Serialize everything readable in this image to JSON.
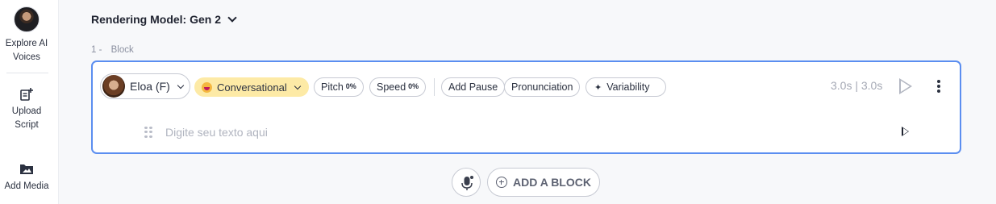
{
  "sidebar": {
    "items": [
      {
        "label_line1": "Explore AI",
        "label_line2": "Voices",
        "icon": "avatar-icon"
      },
      {
        "label_line1": "Upload",
        "label_line2": "Script",
        "icon": "upload-script-icon"
      },
      {
        "label_line1": "Add Media",
        "label_line2": "",
        "icon": "add-media-icon"
      }
    ]
  },
  "header": {
    "model_label": "Rendering Model: Gen 2"
  },
  "block": {
    "index": "1 -",
    "caption": "Block",
    "voice_name": "Eloa (F)",
    "style_label": "Conversational",
    "pitch_label": "Pitch",
    "pitch_value": "0%",
    "speed_label": "Speed",
    "speed_value": "0%",
    "add_pause_label": "Add Pause",
    "pronunciation_label": "Pronunciation",
    "variability_label": "Variability",
    "timing": "3.0s | 3.0s",
    "text_placeholder": "Digite seu texto aqui",
    "text_value": ""
  },
  "footer": {
    "add_block_label": "ADD A BLOCK"
  },
  "colors": {
    "accent_border": "#5b8ef0",
    "style_pill_bg": "#fdeaa6"
  }
}
